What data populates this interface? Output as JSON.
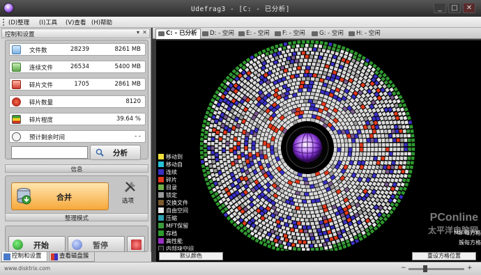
{
  "window": {
    "title": "Udefrag3 - [C: - 已分析]",
    "icon": "app-icon",
    "controls": [
      "_",
      "□",
      "✕"
    ]
  },
  "menu": {
    "items": [
      "(D)整理",
      "(I)工具",
      "(V)查看",
      "(H)帮助"
    ]
  },
  "panel": {
    "title": "控制和设置",
    "pin": "▾",
    "close": "✕"
  },
  "stats": [
    {
      "label": "文件数",
      "count": "28239",
      "size": "8261 MB",
      "icon": "files-icon",
      "color": "#7ab0e0"
    },
    {
      "label": "连续文件",
      "count": "26534",
      "size": "5400 MB",
      "icon": "contiguous-icon",
      "color": "#5fa64a"
    },
    {
      "label": "碎片文件",
      "count": "1705",
      "size": "2861 MB",
      "icon": "fragmented-icon",
      "color": "#d03a2c"
    },
    {
      "label": "碎片数量",
      "count": "",
      "size": "8120",
      "icon": "fragments-icon",
      "color": "#b21818"
    },
    {
      "label": "碎片程度",
      "count": "",
      "size": "39.64 %",
      "icon": "fragmentation-icon",
      "color": "#e0a020"
    },
    {
      "label": "预计剩余时间",
      "count": "",
      "size": "- -",
      "icon": "timer-icon",
      "color": "#eeeeee"
    }
  ],
  "analysis": {
    "input_value": "",
    "button_label": "分析",
    "section_caption": "信息"
  },
  "defrag": {
    "merge_label": "合并",
    "options_label": "选项",
    "section_caption": "整理模式"
  },
  "actions": {
    "start_label": "开始",
    "pause_label": "暂停"
  },
  "bottom_tabs": [
    "控制和设置",
    "查看磁盘簇"
  ],
  "drive_tabs": [
    {
      "label": "C: - 已分析",
      "active": true
    },
    {
      "label": "D: - 空闲",
      "active": false
    },
    {
      "label": "E: - 空闲",
      "active": false
    },
    {
      "label": "F: - 空闲",
      "active": false
    },
    {
      "label": "G: - 空闲",
      "active": false
    },
    {
      "label": "H: - 空闲",
      "active": false
    }
  ],
  "legend": [
    {
      "label": "移动到",
      "color": "#f0e03a"
    },
    {
      "label": "移动自",
      "color": "#27c2d8"
    },
    {
      "label": "连续",
      "color": "#3a30c4"
    },
    {
      "label": "碎片",
      "color": "#e23a1c"
    },
    {
      "label": "目录",
      "color": "#6fb04a"
    },
    {
      "label": "锁定",
      "color": "#9a9a9a"
    },
    {
      "label": "交换文件",
      "color": "#7a5a2e"
    },
    {
      "label": "自由空间",
      "color": "#e8e8e8"
    },
    {
      "label": "压缩",
      "color": "#2ea0b0"
    },
    {
      "label": "MFT保留",
      "color": "#3a9a3a"
    },
    {
      "label": "存档",
      "color": "#2e9a2e"
    },
    {
      "label": "高性能",
      "color": "#9a30c4"
    },
    {
      "label": "内部块空间",
      "color": "#1a1a1a"
    }
  ],
  "map_footer": {
    "left_button": "默认颜色",
    "right_button": "重设方格位置"
  },
  "map_side": {
    "line1": "MB 每方格",
    "line2": "簇每方格"
  },
  "watermark": {
    "brand": "PConline",
    "sub": "太平洋电脑网"
  },
  "status": {
    "url": "www.disktrix.com",
    "zoom_minus": "−",
    "zoom_plus": "+",
    "zoom_level": 0.28
  }
}
